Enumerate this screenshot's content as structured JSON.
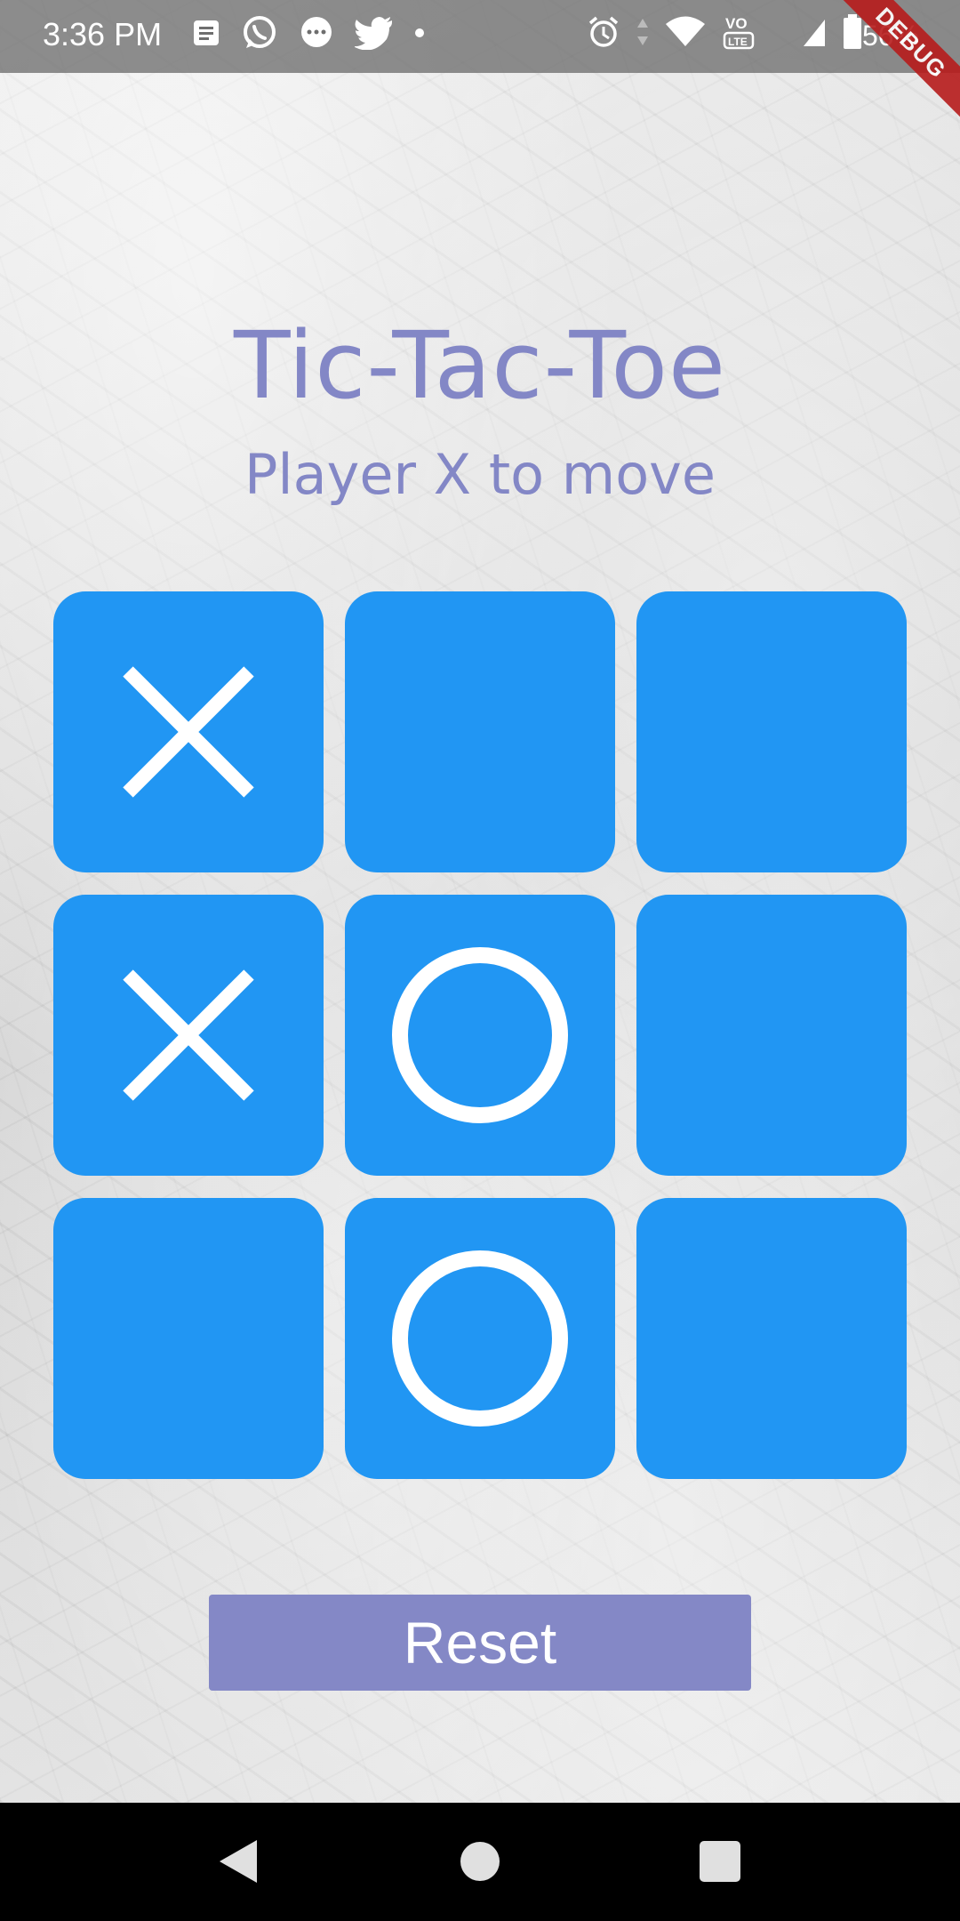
{
  "status_bar": {
    "time": "3:36 PM",
    "battery": "56%",
    "icons_left": [
      "notes-icon",
      "whatsapp-icon",
      "messages-icon",
      "twitter-icon",
      "dot-icon"
    ],
    "icons_right": [
      "alarm-icon",
      "data-arrows-icon",
      "wifi-icon",
      "volte-icon",
      "signal-icon",
      "battery-icon"
    ],
    "debug_label": "DEBUG"
  },
  "header": {
    "title": "Tic-Tac-Toe",
    "status": "Player X to move"
  },
  "board": {
    "cells": [
      "X",
      "",
      "",
      "X",
      "O",
      "",
      "",
      "O",
      ""
    ]
  },
  "controls": {
    "reset_label": "Reset"
  },
  "colors": {
    "accent": "#8387c6",
    "tile": "#2196f3",
    "mark": "#ffffff",
    "button": "#8488c6"
  },
  "nav": {
    "icons": [
      "back-icon",
      "home-icon",
      "recents-icon"
    ]
  }
}
